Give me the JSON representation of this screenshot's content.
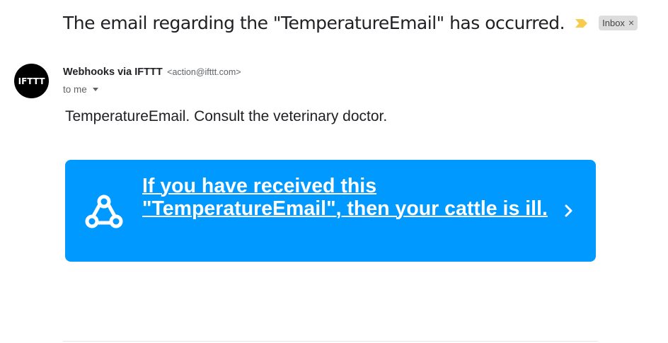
{
  "email": {
    "subject": "The email regarding the \"TemperatureEmail\" has occurred.",
    "label": "Inbox",
    "label_remove": "×",
    "importance_icon": "importance-marker-icon",
    "colors": {
      "importance": "#f7cb4d",
      "cta_background": "#0099ff",
      "avatar_background": "#000000"
    }
  },
  "sender": {
    "avatar_text": "IFTTT",
    "name": "Webhooks via IFTTT",
    "email": "<action@ifttt.com>",
    "recipient": "to me"
  },
  "body": {
    "text": "TemperatureEmail. Consult the veterinary doctor.",
    "cta": {
      "text": "If you have received this \"TemperatureEmail\", then your cattle is ill.",
      "icon": "webhooks-icon",
      "arrow_icon": "chevron-right-icon"
    }
  }
}
